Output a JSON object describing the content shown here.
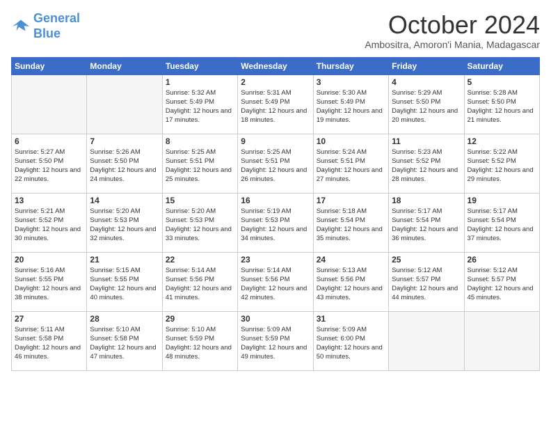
{
  "logo": {
    "line1": "General",
    "line2": "Blue"
  },
  "title": "October 2024",
  "subtitle": "Ambositra, Amoron'i Mania, Madagascar",
  "headers": [
    "Sunday",
    "Monday",
    "Tuesday",
    "Wednesday",
    "Thursday",
    "Friday",
    "Saturday"
  ],
  "weeks": [
    [
      {
        "day": "",
        "info": ""
      },
      {
        "day": "",
        "info": ""
      },
      {
        "day": "1",
        "info": "Sunrise: 5:32 AM\nSunset: 5:49 PM\nDaylight: 12 hours and 17 minutes."
      },
      {
        "day": "2",
        "info": "Sunrise: 5:31 AM\nSunset: 5:49 PM\nDaylight: 12 hours and 18 minutes."
      },
      {
        "day": "3",
        "info": "Sunrise: 5:30 AM\nSunset: 5:49 PM\nDaylight: 12 hours and 19 minutes."
      },
      {
        "day": "4",
        "info": "Sunrise: 5:29 AM\nSunset: 5:50 PM\nDaylight: 12 hours and 20 minutes."
      },
      {
        "day": "5",
        "info": "Sunrise: 5:28 AM\nSunset: 5:50 PM\nDaylight: 12 hours and 21 minutes."
      }
    ],
    [
      {
        "day": "6",
        "info": "Sunrise: 5:27 AM\nSunset: 5:50 PM\nDaylight: 12 hours and 22 minutes."
      },
      {
        "day": "7",
        "info": "Sunrise: 5:26 AM\nSunset: 5:50 PM\nDaylight: 12 hours and 24 minutes."
      },
      {
        "day": "8",
        "info": "Sunrise: 5:25 AM\nSunset: 5:51 PM\nDaylight: 12 hours and 25 minutes."
      },
      {
        "day": "9",
        "info": "Sunrise: 5:25 AM\nSunset: 5:51 PM\nDaylight: 12 hours and 26 minutes."
      },
      {
        "day": "10",
        "info": "Sunrise: 5:24 AM\nSunset: 5:51 PM\nDaylight: 12 hours and 27 minutes."
      },
      {
        "day": "11",
        "info": "Sunrise: 5:23 AM\nSunset: 5:52 PM\nDaylight: 12 hours and 28 minutes."
      },
      {
        "day": "12",
        "info": "Sunrise: 5:22 AM\nSunset: 5:52 PM\nDaylight: 12 hours and 29 minutes."
      }
    ],
    [
      {
        "day": "13",
        "info": "Sunrise: 5:21 AM\nSunset: 5:52 PM\nDaylight: 12 hours and 30 minutes."
      },
      {
        "day": "14",
        "info": "Sunrise: 5:20 AM\nSunset: 5:53 PM\nDaylight: 12 hours and 32 minutes."
      },
      {
        "day": "15",
        "info": "Sunrise: 5:20 AM\nSunset: 5:53 PM\nDaylight: 12 hours and 33 minutes."
      },
      {
        "day": "16",
        "info": "Sunrise: 5:19 AM\nSunset: 5:53 PM\nDaylight: 12 hours and 34 minutes."
      },
      {
        "day": "17",
        "info": "Sunrise: 5:18 AM\nSunset: 5:54 PM\nDaylight: 12 hours and 35 minutes."
      },
      {
        "day": "18",
        "info": "Sunrise: 5:17 AM\nSunset: 5:54 PM\nDaylight: 12 hours and 36 minutes."
      },
      {
        "day": "19",
        "info": "Sunrise: 5:17 AM\nSunset: 5:54 PM\nDaylight: 12 hours and 37 minutes."
      }
    ],
    [
      {
        "day": "20",
        "info": "Sunrise: 5:16 AM\nSunset: 5:55 PM\nDaylight: 12 hours and 38 minutes."
      },
      {
        "day": "21",
        "info": "Sunrise: 5:15 AM\nSunset: 5:55 PM\nDaylight: 12 hours and 40 minutes."
      },
      {
        "day": "22",
        "info": "Sunrise: 5:14 AM\nSunset: 5:56 PM\nDaylight: 12 hours and 41 minutes."
      },
      {
        "day": "23",
        "info": "Sunrise: 5:14 AM\nSunset: 5:56 PM\nDaylight: 12 hours and 42 minutes."
      },
      {
        "day": "24",
        "info": "Sunrise: 5:13 AM\nSunset: 5:56 PM\nDaylight: 12 hours and 43 minutes."
      },
      {
        "day": "25",
        "info": "Sunrise: 5:12 AM\nSunset: 5:57 PM\nDaylight: 12 hours and 44 minutes."
      },
      {
        "day": "26",
        "info": "Sunrise: 5:12 AM\nSunset: 5:57 PM\nDaylight: 12 hours and 45 minutes."
      }
    ],
    [
      {
        "day": "27",
        "info": "Sunrise: 5:11 AM\nSunset: 5:58 PM\nDaylight: 12 hours and 46 minutes."
      },
      {
        "day": "28",
        "info": "Sunrise: 5:10 AM\nSunset: 5:58 PM\nDaylight: 12 hours and 47 minutes."
      },
      {
        "day": "29",
        "info": "Sunrise: 5:10 AM\nSunset: 5:59 PM\nDaylight: 12 hours and 48 minutes."
      },
      {
        "day": "30",
        "info": "Sunrise: 5:09 AM\nSunset: 5:59 PM\nDaylight: 12 hours and 49 minutes."
      },
      {
        "day": "31",
        "info": "Sunrise: 5:09 AM\nSunset: 6:00 PM\nDaylight: 12 hours and 50 minutes."
      },
      {
        "day": "",
        "info": ""
      },
      {
        "day": "",
        "info": ""
      }
    ]
  ]
}
